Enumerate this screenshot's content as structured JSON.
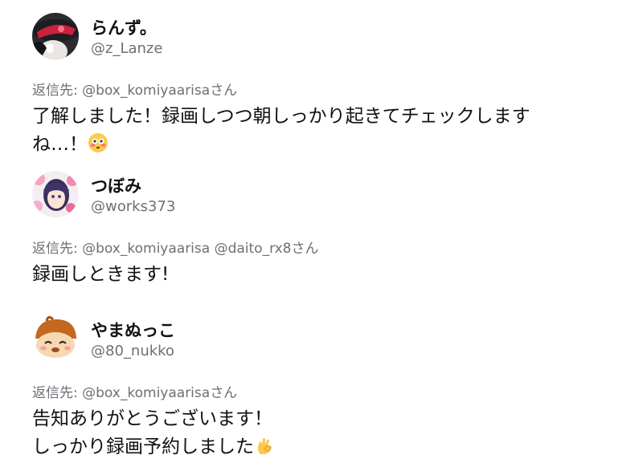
{
  "tweets": [
    {
      "name": "らんず。",
      "handle": "@z_Lanze",
      "reply_prefix": "返信先: ",
      "reply_mentions": "@box_komiyaarisa",
      "reply_suffix": "さん",
      "text_lines": [
        "了解しました！録画しつつ朝しっかり起きてチェックします",
        "ね…！"
      ],
      "emoji": "flushed-face-emoji"
    },
    {
      "name": "つぼみ",
      "handle": "@works373",
      "reply_prefix": "返信先: ",
      "reply_mentions": "@box_komiyaarisa @daito_rx8",
      "reply_suffix": "さん",
      "text_lines": [
        "録画しときます!"
      ]
    },
    {
      "name": "やまぬっこ",
      "handle": "@80_nukko",
      "reply_prefix": "返信先: ",
      "reply_mentions": "@box_komiyaarisa",
      "reply_suffix": "さん",
      "text_lines": [
        "告知ありがとうございます！",
        "しっかり録画予約しました"
      ],
      "emoji": "ok-hand-emoji"
    }
  ],
  "colors": {
    "text": "#111111",
    "muted": "#6b7075",
    "background": "#ffffff"
  }
}
